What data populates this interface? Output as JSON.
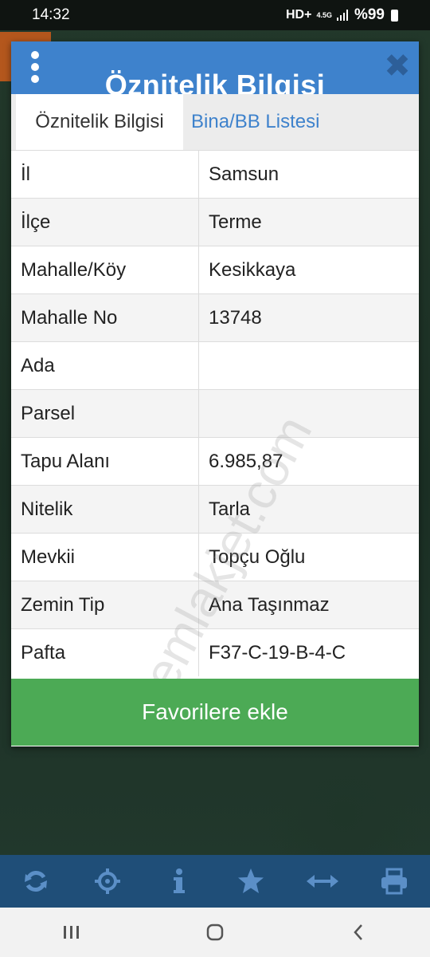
{
  "status_bar": {
    "time": "14:32",
    "network": "HD+",
    "signal_label": "4.5G",
    "battery": "%99"
  },
  "dialog": {
    "title": "Öznitelik Bilgisi",
    "tabs": [
      {
        "label": "Öznitelik Bilgisi"
      },
      {
        "label": "Bina/BB Listesi"
      }
    ],
    "rows": [
      {
        "label": "İl",
        "value": "Samsun"
      },
      {
        "label": "İlçe",
        "value": "Terme"
      },
      {
        "label": "Mahalle/Köy",
        "value": "Kesikkaya"
      },
      {
        "label": "Mahalle No",
        "value": "13748"
      },
      {
        "label": "Ada",
        "value": ""
      },
      {
        "label": "Parsel",
        "value": ""
      },
      {
        "label": "Tapu Alanı",
        "value": "6.985,87"
      },
      {
        "label": "Nitelik",
        "value": "Tarla"
      },
      {
        "label": "Mevkii",
        "value": "Topçu Oğlu"
      },
      {
        "label": "Zemin Tip",
        "value": "Ana Taşınmaz"
      },
      {
        "label": "Pafta",
        "value": "F37-C-19-B-4-C"
      }
    ],
    "favorite_button": "Favorilere ekle"
  },
  "watermark": "emlakjet.com",
  "toolbar": {
    "icons": [
      "refresh-icon",
      "locate-icon",
      "info-icon",
      "star-icon",
      "measure-icon",
      "print-icon"
    ]
  },
  "colors": {
    "header": "#3e82cc",
    "button": "#4caa55",
    "toolbar": "#1f4e78",
    "toolbar_icon": "#5b8fc7"
  }
}
